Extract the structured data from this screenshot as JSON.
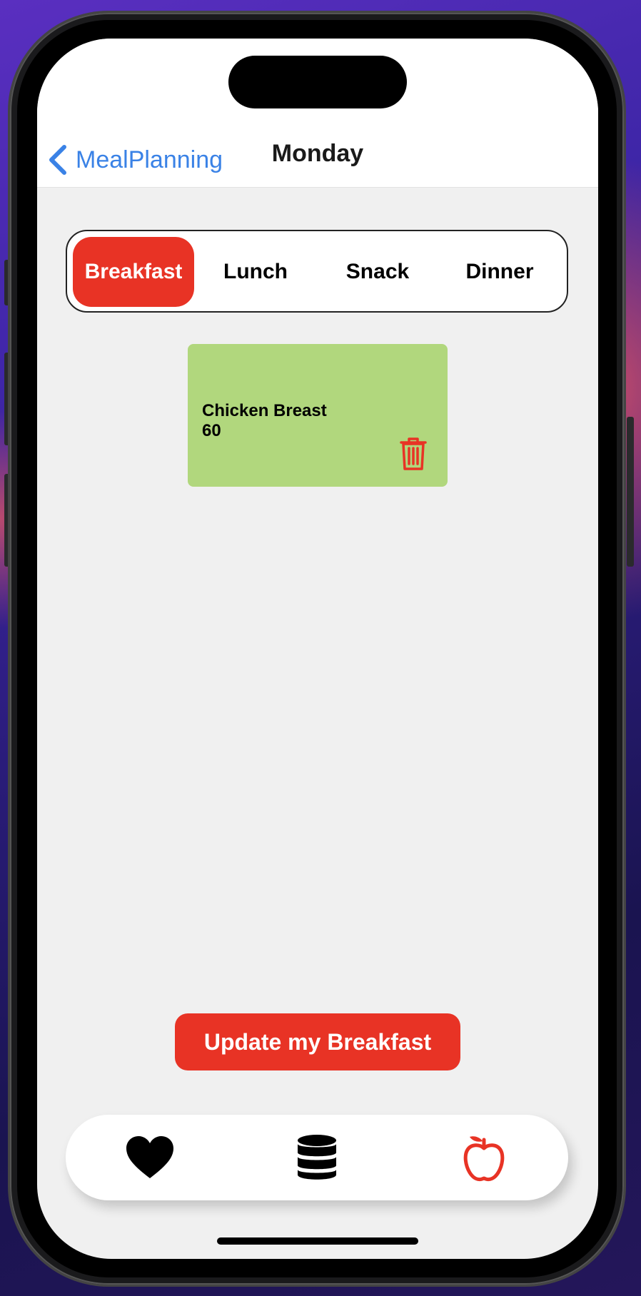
{
  "nav": {
    "back_label": "MealPlanning",
    "title": "Monday"
  },
  "segments": [
    {
      "label": "Breakfast",
      "selected": true
    },
    {
      "label": "Lunch",
      "selected": false
    },
    {
      "label": "Snack",
      "selected": false
    },
    {
      "label": "Dinner",
      "selected": false
    }
  ],
  "meals": [
    {
      "name": "Chicken Breast",
      "value": "60"
    }
  ],
  "update_button_label": "Update my Breakfast",
  "tab_bar": {
    "items": [
      {
        "icon": "heart-icon",
        "selected": false
      },
      {
        "icon": "database-icon",
        "selected": false
      },
      {
        "icon": "apple-icon",
        "selected": true
      }
    ]
  },
  "colors": {
    "accent": "#e83325",
    "link": "#3a82e6",
    "card": "#b1d77d",
    "background": "#f0f0f0"
  }
}
